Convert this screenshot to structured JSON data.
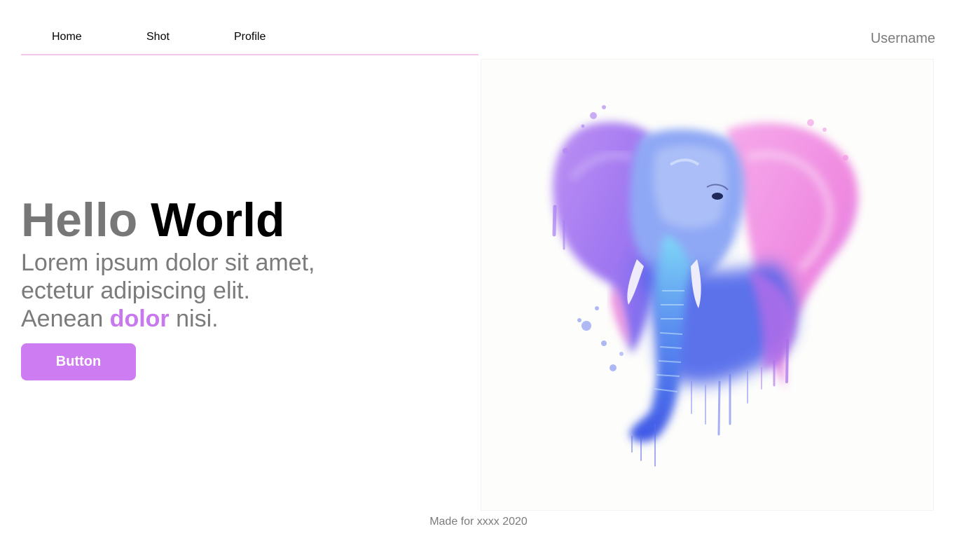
{
  "nav": {
    "items": [
      {
        "label": "Home"
      },
      {
        "label": "Shot"
      },
      {
        "label": "Profile"
      }
    ],
    "username": "Username"
  },
  "hero": {
    "title_part1": "Hello",
    "title_part2": "World",
    "subtitle_line1": "Lorem ipsum dolor sit amet,",
    "subtitle_line2": "ectetur adipiscing elit.",
    "subtitle_line3_before": "Aenean ",
    "subtitle_line3_accent": "dolor",
    "subtitle_line3_after": " nisi.",
    "button_label": "Button"
  },
  "artwork": {
    "subject": "watercolor-elephant",
    "colors": [
      "#a86ef0",
      "#f08ee0",
      "#4a6ff0",
      "#6fd3f5",
      "#3e58e8"
    ]
  },
  "footer": {
    "text": "Made for xxxx 2020"
  },
  "colors": {
    "accent": "#cd7cf2",
    "accent_text": "#c979ef",
    "nav_underline": "#f4c6ee",
    "muted_text": "#7b7b7b"
  }
}
